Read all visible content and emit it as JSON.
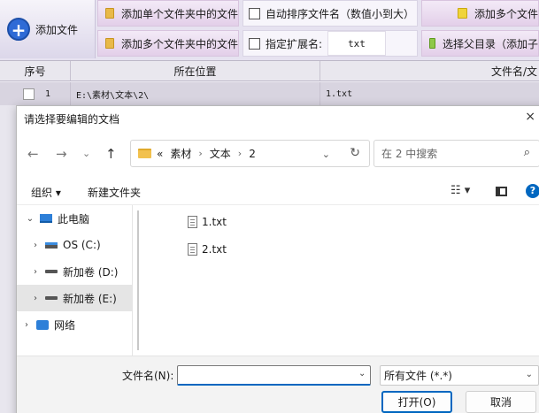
{
  "toolbar": {
    "add_file_label": "添加文件",
    "add_single_folder_label": "添加单个文件夹中的文件",
    "add_multi_folder_label": "添加多个文件夹中的文件",
    "add_multi_folder_label_right": "添加多个文件",
    "auto_sort_label": "自动排序文件名（数值小到大）",
    "specify_ext_label": "指定扩展名:",
    "ext_value": "txt",
    "select_parent_label": "选择父目录（添加子"
  },
  "table": {
    "headers": {
      "index": "序号",
      "location": "所在位置",
      "filename": "文件名/文"
    },
    "rows": [
      {
        "index": "1",
        "location": "E:\\素材\\文本\\2\\",
        "filename": "1.txt"
      }
    ]
  },
  "dialog": {
    "title": "请选择要编辑的文档",
    "close": "×",
    "breadcrumb": [
      "«",
      "素材",
      "文本",
      "2"
    ],
    "search_placeholder": "在 2 中搜索",
    "organize": "组织 ▾",
    "new_folder": "新建文件夹",
    "tree": [
      {
        "label": "此电脑",
        "chevron": "⌄"
      },
      {
        "label": "OS (C:)",
        "chevron": "›"
      },
      {
        "label": "新加卷 (D:)",
        "chevron": "›"
      },
      {
        "label": "新加卷 (E:)",
        "chevron": "›"
      },
      {
        "label": "网络",
        "chevron": "›"
      }
    ],
    "files": [
      "1.txt",
      "2.txt"
    ],
    "filename_label": "文件名(N):",
    "filename_value": "",
    "filter_value": "所有文件 (*.*)",
    "open_button": "打开(O)",
    "cancel_button": "取消"
  },
  "colors": {
    "accent": "#0067c0",
    "selection": "#e5e5e5",
    "toolbar_pink": "#e3cfe9"
  }
}
